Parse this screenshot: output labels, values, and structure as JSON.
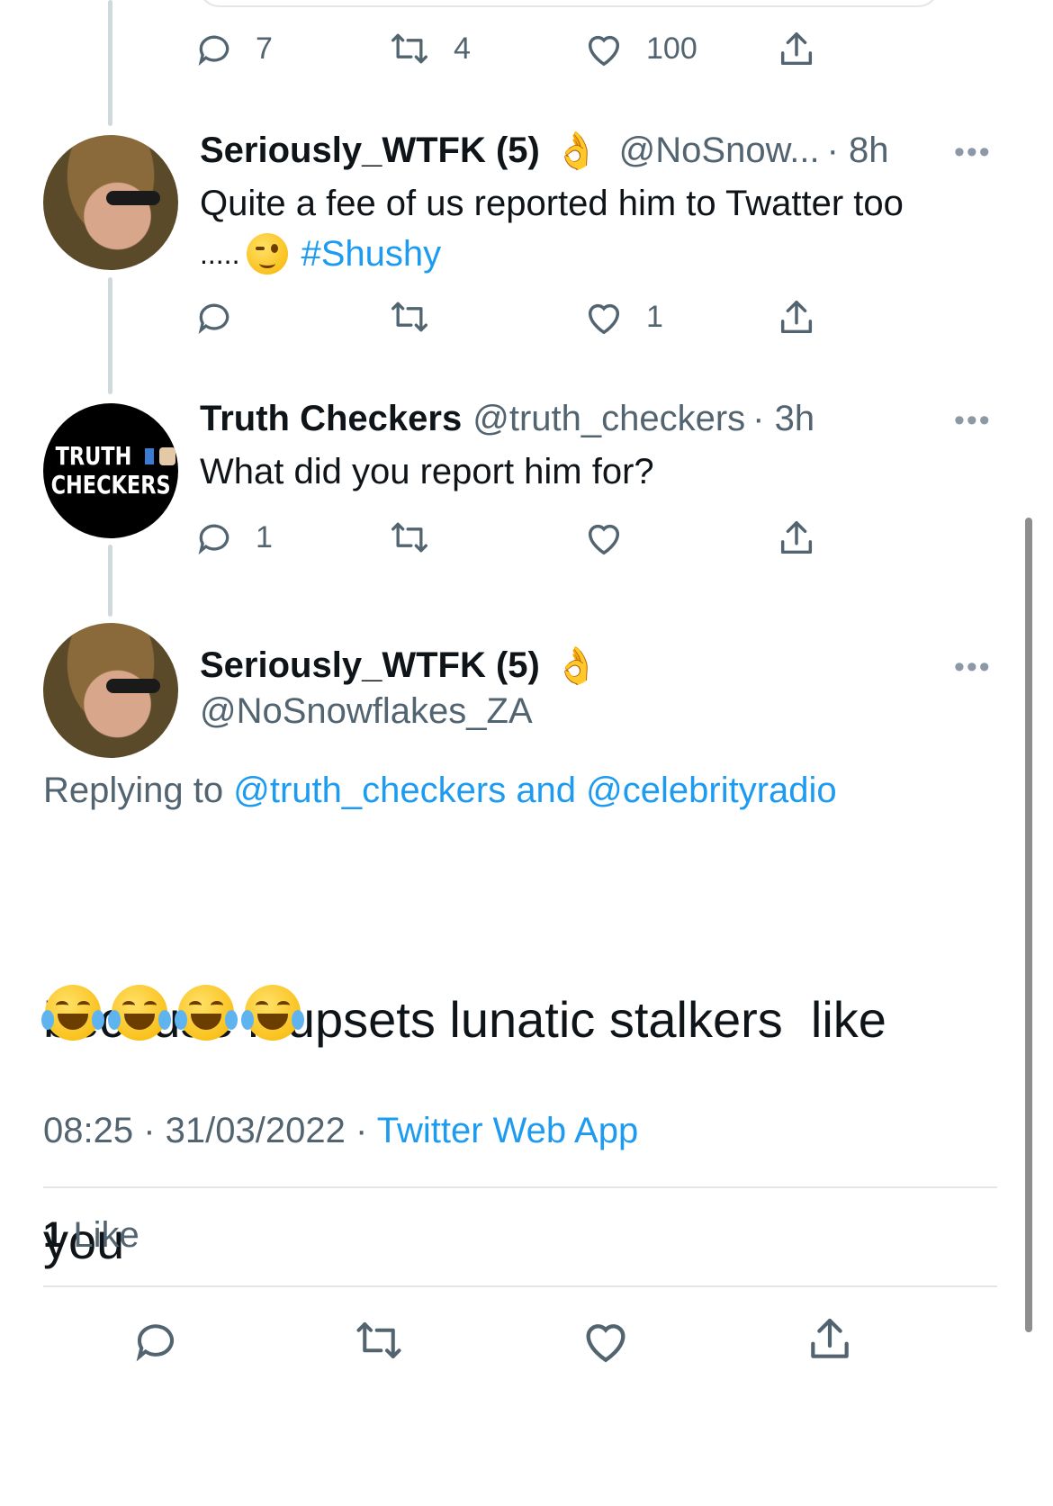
{
  "tweet0": {
    "actions": {
      "reply": "7",
      "retweet": "4",
      "like": "100"
    }
  },
  "reply1": {
    "name": "Seriously_WTFK (5)",
    "handle": "@NoSnow...",
    "time": "· 8h",
    "text_line1": "Quite a fee of us reported him to Twatter too",
    "text_line2_prefix": ".....",
    "hashtag": "#Shushy",
    "actions": {
      "reply": "",
      "retweet": "",
      "like": "1"
    }
  },
  "reply2": {
    "name": "Truth Checkers",
    "handle": "@truth_checkers",
    "time": "· 3h",
    "avatar_text_1": "TRUTH",
    "avatar_text_2": "CHECKERS",
    "text": "What did you report him for?",
    "actions": {
      "reply": "1",
      "retweet": "",
      "like": ""
    }
  },
  "main_tweet": {
    "name": "Seriously_WTFK (5)",
    "handle": "@NoSnowflakes_ZA",
    "replying_prefix": "Replying to",
    "replying_users": "@truth_checkers and @celebrityradio",
    "text_line1": "because it upsets lunatic stalkers  like",
    "text_line2": "you",
    "time": "08:25",
    "date": "31/03/2022",
    "source": "Twitter Web App",
    "likes_count": "1",
    "likes_label": "Like"
  },
  "more_label": "•••",
  "colors": {
    "accent": "#1d9bf0",
    "secondary": "#536471",
    "divider": "#e1e6ea"
  }
}
